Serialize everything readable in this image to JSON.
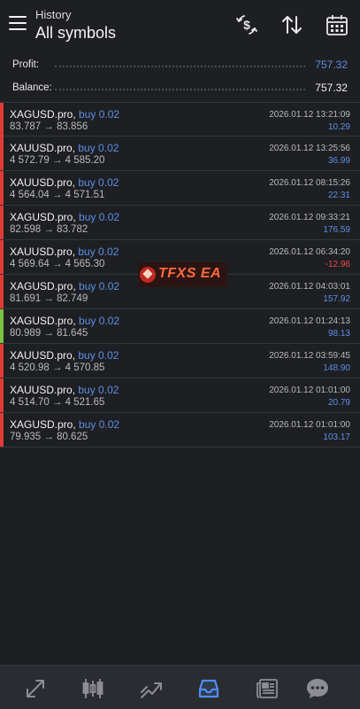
{
  "header": {
    "subtitle": "History",
    "title": "All symbols",
    "icons": [
      "menu-icon",
      "dollar-exchange-icon",
      "sort-icon",
      "calendar-icon"
    ]
  },
  "summary": {
    "profit_label": "Profit:",
    "profit_value": "757.32",
    "balance_label": "Balance:",
    "balance_value": "757.32"
  },
  "trades": [
    {
      "symbol": "XAGUSD.pro,",
      "side": "buy 0.02",
      "prices": "83.787 → 83.856",
      "time": "2026.01.12 13:21:09",
      "profit": "10.29",
      "status": "red"
    },
    {
      "symbol": "XAUUSD.pro,",
      "side": "buy 0.02",
      "prices": "4 572.79 → 4 585.20",
      "time": "2026.01.12 13:25:56",
      "profit": "36.99",
      "status": "red"
    },
    {
      "symbol": "XAUUSD.pro,",
      "side": "buy 0.02",
      "prices": "4 564.04 → 4 571.51",
      "time": "2026.01.12 08:15:26",
      "profit": "22.31",
      "status": "red"
    },
    {
      "symbol": "XAGUSD.pro,",
      "side": "buy 0.02",
      "prices": "82.598 → 83.782",
      "time": "2026.01.12 09:33:21",
      "profit": "176.59",
      "status": "red"
    },
    {
      "symbol": "XAUUSD.pro,",
      "side": "buy 0.02",
      "prices": "4 569.64 → 4 565.30",
      "time": "2026.01.12 06:34:20",
      "profit": "-12.96",
      "status": "red"
    },
    {
      "symbol": "XAGUSD.pro,",
      "side": "buy 0.02",
      "prices": "81.691 → 82.749",
      "time": "2026.01.12 04:03:01",
      "profit": "157.92",
      "status": "red"
    },
    {
      "symbol": "XAGUSD.pro,",
      "side": "buy 0.02",
      "prices": "80.989 → 81.645",
      "time": "2026.01.12 01:24:13",
      "profit": "98.13",
      "status": "green"
    },
    {
      "symbol": "XAUUSD.pro,",
      "side": "buy 0.02",
      "prices": "4 520.98 → 4 570.85",
      "time": "2026.01.12 03:59:45",
      "profit": "148.90",
      "status": "red"
    },
    {
      "symbol": "XAUUSD.pro,",
      "side": "buy 0.02",
      "prices": "4 514.70 → 4 521.65",
      "time": "2026.01.12 01:01:00",
      "profit": "20.79",
      "status": "red"
    },
    {
      "symbol": "XAGUSD.pro,",
      "side": "buy 0.02",
      "prices": "79.935 → 80.625",
      "time": "2026.01.12 01:01:00",
      "profit": "103.17",
      "status": "red"
    }
  ],
  "watermark": {
    "text": "TFXS EA"
  },
  "bottom_nav": [
    {
      "name": "nav-quotes-icon"
    },
    {
      "name": "nav-chart-icon"
    },
    {
      "name": "nav-trade-icon"
    },
    {
      "name": "nav-history-icon",
      "active": true
    },
    {
      "name": "nav-news-icon"
    },
    {
      "name": "nav-messages-icon"
    }
  ],
  "colors": {
    "background": "#1e1f23",
    "accent_blue": "#5c8fe6",
    "loss_red": "#ec4b46",
    "status_red": "#e03b36",
    "status_green": "#7cc142",
    "nav_bg": "#2b2c31"
  }
}
